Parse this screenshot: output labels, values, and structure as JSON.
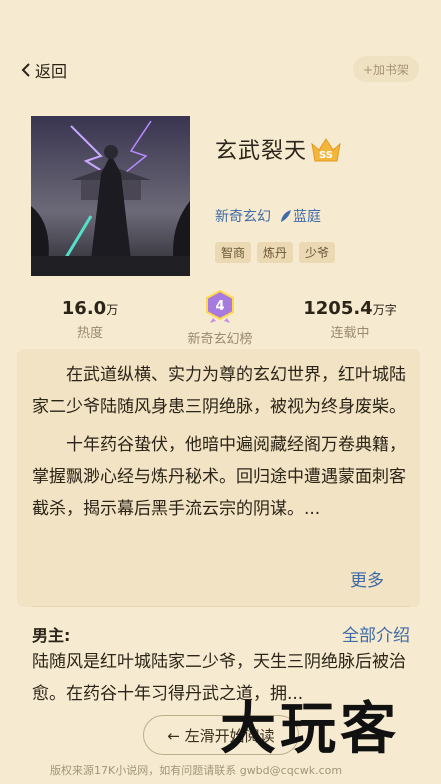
{
  "nav": {
    "back_label": "返回",
    "add_shelf_label": "+加书架"
  },
  "book": {
    "title": "玄武裂天",
    "rank_badge": "SS",
    "category": "新奇玄幻",
    "channel": "蓝庭",
    "tags": [
      "智商",
      "炼丹",
      "少爷"
    ]
  },
  "stats": {
    "heat": {
      "value": "16.0",
      "unit": "万",
      "label": "热度"
    },
    "rank": {
      "value": "4",
      "label": "新奇玄幻榜"
    },
    "words": {
      "value": "1205.4",
      "unit": "万字",
      "label": "连载中"
    }
  },
  "description": {
    "paragraphs": [
      "在武道纵横、实力为尊的玄幻世界，红叶城陆家二少爷陆随风身患三阴绝脉，被视为终身废柴。",
      "十年药谷蛰伏，他暗中遍阅藏经阁万卷典籍，掌握飘渺心经与炼丹秘术。回归途中遭遇蒙面刺客截杀，揭示幕后黑手流云宗的阴谋。..."
    ],
    "more_label": "更多"
  },
  "protagonist": {
    "heading": "男主:",
    "all_link": "全部介绍",
    "text": "陆随风是红叶城陆家二少爷，天生三阴绝脉后被治愈。在药谷十年习得丹武之道，拥..."
  },
  "footer": {
    "swipe_label": "← 左滑开始阅读",
    "copyright": "版权来源17K小说网，如有问题请联系 gwbd@cqcwk.com"
  },
  "watermark": "大玩客",
  "colors": {
    "background": "#f6ebd0",
    "link": "#3e6aa8",
    "card": "#f1e3c3"
  }
}
